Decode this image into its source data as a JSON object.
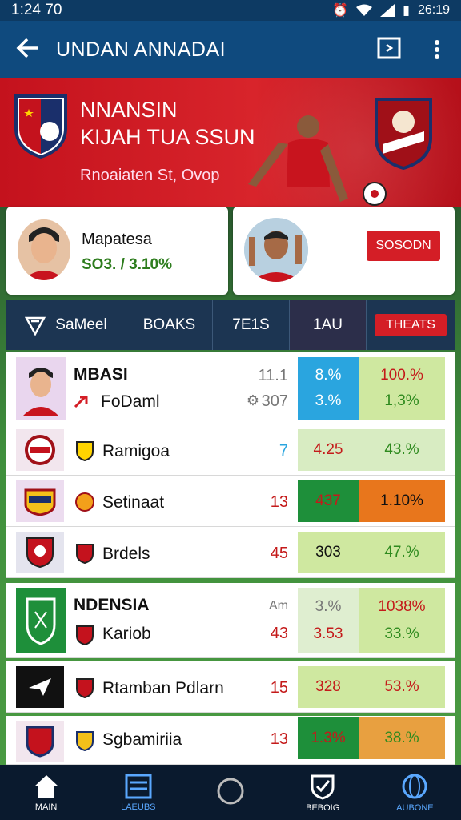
{
  "status": {
    "time": "1:24 70",
    "right_text": "26:19"
  },
  "appbar": {
    "title": "UNDAN ANNADAI"
  },
  "banner": {
    "line1": "NNANSIN",
    "line2": "KIJAH TUA SSUN",
    "subtitle": "Rnoaiaten St, Ovop"
  },
  "cards": {
    "left": {
      "name": "Mapatesa",
      "value": "SO3. / 3.10%"
    },
    "right": {
      "button_label": "SOSODN"
    }
  },
  "tabs": [
    "SaMeel",
    "BOAKS",
    "7E1S",
    "1AU",
    "THEATS"
  ],
  "groups": [
    {
      "header": {
        "title": "MBASI",
        "num": "11.1",
        "c1": "8.%",
        "c2": "100.%"
      },
      "rows": [
        {
          "name": "FoDaml",
          "num": "307",
          "c1": "3.%",
          "c2": "1,3%"
        },
        {
          "name": "Ramigoa",
          "num": "7",
          "c1": "4.25",
          "c2": "43.%"
        },
        {
          "name": "Setinaat",
          "num": "13",
          "c1": "437",
          "c2": "1.10%"
        },
        {
          "name": "Brdels",
          "num": "45",
          "c1": "303",
          "c2": "47.%"
        }
      ]
    },
    {
      "header": {
        "title": "NDENSIA",
        "num": "Am",
        "c1": "3.%",
        "c2": "1038%"
      },
      "rows": [
        {
          "name": "Kariob",
          "num": "43",
          "c1": "3.53",
          "c2": "33.%"
        },
        {
          "name": "Rtamban Pdlarn",
          "num": "15",
          "c1": "328",
          "c2": "53.%"
        },
        {
          "name": "Sgbamiriia",
          "num": "13",
          "c1": "1.3%",
          "c2": "38.%"
        }
      ]
    }
  ],
  "bottom_nav": [
    "MAIN",
    "LAEUBS",
    "",
    "BEBOIG",
    "AUBONE"
  ],
  "colors": {
    "accent": "#d8242b",
    "navy": "#0f4a7e",
    "green": "#1e8f3a",
    "orange": "#e8761c",
    "lime": "#cfe8a0",
    "sky": "#2aa5df"
  }
}
